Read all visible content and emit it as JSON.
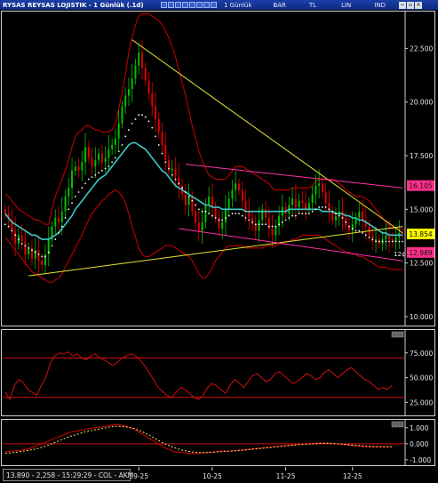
{
  "titlebar": {
    "title": "RYSAS REYSAS LOJISTIK - 1 Günlük (.1d)",
    "menu": [
      "1 Günlük",
      "BAR",
      "TL",
      "LIN",
      "IND"
    ],
    "controls": [
      "−",
      "▫",
      "×"
    ]
  },
  "status": {
    "text": "13.890 - 2,258 - 15:29:29 - COL - AKM"
  },
  "colors": {
    "background": "#000000",
    "candle_up": "#00c000",
    "candle_down": "#e00000",
    "bollinger": "#c00000",
    "moving_average": "#3cc8c8",
    "parabolic": "#ffffff",
    "trend_line": "#e6e632",
    "channel_line": "#ff2fa8",
    "level_yellow": "#ffff00",
    "level_pink": "#ff2f8a",
    "oscillator": "#d01010",
    "macd": "#c00000",
    "macd_signal": "#ffe070"
  },
  "chart_data": [
    {
      "type": "candlestick",
      "panel": "price",
      "ylim": [
        9.5,
        24.3
      ],
      "y_ticks": [
        "22.500",
        "20.000",
        "17.500",
        "15.000",
        "12.500",
        "10.000"
      ],
      "x_ticks": [
        "09-25",
        "10-25",
        "11-25",
        "12-25"
      ],
      "x_tick_positions": [
        40,
        62,
        84,
        104
      ],
      "n_bars": 120,
      "close": [
        14.8,
        14.5,
        14.0,
        13.4,
        13.8,
        13.5,
        12.9,
        13.2,
        12.7,
        13.1,
        12.6,
        12.4,
        12.9,
        13.6,
        14.2,
        14.6,
        14.4,
        14.9,
        15.6,
        16.0,
        16.8,
        17.0,
        16.8,
        17.2,
        17.9,
        17.4,
        17.0,
        17.3,
        17.6,
        17.2,
        17.4,
        17.8,
        18.0,
        18.3,
        19.0,
        19.8,
        20.3,
        20.6,
        21.1,
        21.7,
        22.3,
        21.6,
        21.0,
        20.4,
        19.8,
        19.2,
        18.6,
        18.0,
        17.3,
        16.8,
        16.9,
        16.5,
        16.1,
        15.7,
        15.2,
        15.6,
        14.9,
        14.4,
        14.0,
        14.4,
        15.2,
        15.6,
        15.1,
        14.6,
        14.1,
        14.4,
        15.0,
        15.5,
        15.9,
        16.2,
        15.9,
        15.4,
        14.9,
        14.6,
        14.3,
        14.0,
        14.5,
        15.0,
        14.6,
        14.1,
        13.8,
        14.2,
        14.7,
        15.1,
        14.8,
        15.2,
        15.5,
        15.1,
        15.4,
        15.3,
        15.0,
        15.3,
        15.7,
        16.1,
        16.2,
        15.8,
        15.3,
        14.9,
        14.5,
        14.7,
        14.9,
        14.6,
        14.2,
        14.0,
        14.3,
        14.6,
        14.9,
        14.5,
        14.2,
        13.8,
        13.5,
        13.6,
        13.4,
        13.6,
        13.8,
        13.6,
        13.5,
        13.7,
        13.9,
        13.85
      ],
      "bollinger_upper": [
        15.7,
        15.6,
        15.4,
        15.2,
        15.0,
        14.9,
        14.8,
        14.7,
        14.6,
        14.5,
        14.5,
        14.4,
        14.3,
        14.3,
        15.0,
        15.6,
        16.0,
        16.4,
        16.8,
        17.3,
        17.9,
        18.4,
        18.6,
        18.7,
        18.9,
        18.9,
        18.8,
        18.7,
        18.7,
        18.6,
        18.6,
        18.6,
        18.7,
        19.0,
        19.7,
        20.4,
        21.3,
        22.3,
        23.0,
        23.6,
        24.0,
        24.1,
        24.1,
        24.1,
        24.0,
        23.9,
        23.8,
        23.6,
        23.3,
        23.0,
        22.6,
        22.1,
        21.5,
        20.9,
        20.3,
        19.6,
        18.9,
        18.3,
        17.7,
        17.3,
        16.9,
        16.6,
        16.5,
        16.4,
        16.4,
        16.4,
        16.4,
        16.6,
        16.8,
        17.0,
        17.0,
        17.0,
        16.9,
        16.8,
        16.7,
        16.6,
        16.5,
        16.4,
        16.3,
        16.2,
        16.0,
        15.9,
        15.9,
        15.9,
        15.9,
        15.9,
        16.0,
        16.0,
        16.0,
        16.0,
        16.0,
        16.0,
        16.1,
        16.3,
        16.4,
        16.4,
        16.4,
        16.4,
        16.4,
        16.3,
        16.2,
        16.1,
        15.9,
        15.8,
        15.7,
        15.6,
        15.6,
        15.6,
        15.5,
        15.4,
        15.2,
        15.0,
        14.8,
        14.6,
        14.4,
        14.2,
        14.1,
        14.1,
        14.1,
        14.1
      ],
      "bollinger_lower": [
        13.7,
        13.5,
        13.3,
        13.1,
        12.9,
        12.7,
        12.5,
        12.3,
        12.1,
        12.0,
        11.9,
        11.8,
        11.7,
        11.6,
        11.6,
        11.7,
        11.8,
        12.0,
        12.3,
        12.6,
        12.9,
        13.2,
        13.5,
        13.8,
        14.2,
        14.5,
        14.8,
        15.0,
        15.2,
        15.4,
        15.5,
        15.7,
        15.8,
        15.9,
        15.8,
        15.6,
        15.3,
        14.8,
        14.2,
        13.7,
        13.2,
        12.9,
        12.8,
        12.8,
        12.9,
        13.0,
        13.1,
        13.2,
        13.3,
        13.3,
        13.3,
        13.2,
        13.1,
        13.0,
        12.9,
        12.8,
        12.6,
        12.3,
        12.0,
        11.8,
        11.8,
        12.0,
        12.3,
        12.6,
        12.8,
        13.0,
        13.2,
        13.3,
        13.3,
        13.3,
        13.3,
        13.3,
        13.2,
        13.2,
        13.2,
        13.2,
        13.2,
        13.2,
        13.3,
        13.3,
        13.3,
        13.3,
        13.4,
        13.4,
        13.5,
        13.5,
        13.6,
        13.6,
        13.7,
        13.8,
        13.8,
        13.8,
        13.8,
        13.8,
        13.8,
        13.7,
        13.6,
        13.5,
        13.4,
        13.3,
        13.2,
        13.1,
        13.0,
        13.0,
        12.9,
        12.9,
        12.8,
        12.8,
        12.7,
        12.6,
        12.5,
        12.4,
        12.3,
        12.3,
        12.3,
        12.2,
        12.2,
        12.2,
        12.2,
        12.2
      ],
      "moving_average": [
        14.8,
        14.6,
        14.4,
        14.3,
        14.2,
        14.1,
        14.0,
        13.9,
        13.8,
        13.8,
        13.7,
        13.6,
        13.6,
        13.6,
        13.7,
        13.8,
        13.9,
        14.1,
        14.3,
        14.5,
        14.7,
        15.0,
        15.2,
        15.4,
        15.6,
        15.8,
        16.0,
        16.2,
        16.4,
        16.5,
        16.6,
        16.8,
        17.0,
        17.2,
        17.4,
        17.6,
        17.8,
        18.0,
        18.1,
        18.1,
        18.0,
        17.9,
        17.8,
        17.6,
        17.4,
        17.2,
        17.0,
        16.8,
        16.7,
        16.5,
        16.3,
        16.1,
        16.0,
        15.9,
        15.8,
        15.7,
        15.6,
        15.5,
        15.4,
        15.3,
        15.2,
        15.2,
        15.1,
        15.1,
        15.1,
        15.0,
        15.0,
        15.0,
        15.0,
        15.0,
        15.0,
        15.0,
        14.9,
        14.9,
        14.9,
        14.9,
        14.9,
        14.9,
        14.9,
        14.9,
        14.9,
        14.9,
        14.9,
        14.9,
        14.9,
        15.0,
        15.0,
        15.0,
        15.0,
        15.0,
        15.0,
        15.0,
        15.0,
        15.0,
        15.0,
        14.9,
        14.9,
        14.9,
        14.9,
        14.8,
        14.8,
        14.8,
        14.7,
        14.7,
        14.6,
        14.6,
        14.5,
        14.5,
        14.4,
        14.3,
        14.2,
        14.1,
        14.0,
        13.9,
        13.9,
        13.8,
        13.8,
        13.8,
        13.8,
        13.8
      ],
      "parabolic_sar": [
        14.3,
        14.2,
        14.0,
        13.8,
        13.6,
        13.4,
        13.3,
        13.2,
        13.1,
        13.0,
        12.9,
        12.8,
        12.8,
        13.0,
        13.3,
        13.6,
        13.9,
        14.2,
        14.6,
        15.0,
        15.3,
        15.6,
        15.8,
        16.0,
        16.2,
        16.4,
        16.5,
        16.6,
        16.7,
        16.8,
        16.9,
        17.0,
        17.2,
        17.4,
        17.7,
        18.0,
        18.4,
        18.7,
        19.0,
        19.2,
        19.4,
        19.4,
        19.3,
        19.1,
        18.8,
        18.4,
        18.0,
        17.6,
        17.2,
        16.9,
        16.6,
        16.4,
        16.2,
        16.0,
        15.8,
        15.6,
        15.4,
        15.2,
        15.0,
        14.9,
        14.9,
        14.8,
        14.7,
        14.6,
        14.5,
        14.5,
        14.6,
        14.7,
        14.8,
        14.8,
        14.8,
        14.7,
        14.6,
        14.5,
        14.4,
        14.3,
        14.3,
        14.3,
        14.3,
        14.2,
        14.2,
        14.2,
        14.3,
        14.4,
        14.5,
        14.6,
        14.7,
        14.7,
        14.8,
        14.8,
        14.8,
        14.8,
        14.9,
        15.0,
        15.1,
        15.1,
        15.1,
        15.0,
        14.9,
        14.8,
        14.7,
        14.6,
        14.4,
        14.2,
        14.1,
        14.0,
        14.0,
        13.9,
        13.8,
        13.7,
        13.6,
        13.5,
        13.5,
        13.5,
        13.5,
        13.5,
        13.5,
        13.5,
        13.5,
        13.5
      ],
      "trend_lines": [
        {
          "color": "yellow",
          "from": [
            38,
            22.9
          ],
          "to": [
            119,
            13.9
          ]
        },
        {
          "color": "yellow",
          "from": [
            7,
            11.9
          ],
          "to": [
            119,
            14.2
          ]
        },
        {
          "color": "pink",
          "from": [
            54,
            17.1
          ],
          "to": [
            119,
            16.0
          ]
        },
        {
          "color": "pink",
          "from": [
            52,
            14.1
          ],
          "to": [
            119,
            12.6
          ]
        }
      ],
      "price_labels": [
        {
          "text": "16.105",
          "value": 16.105,
          "style": "pink"
        },
        {
          "text": "13.854",
          "value": 13.854,
          "style": "yellow"
        },
        {
          "text": "12.989",
          "value": 12.989,
          "style": "pink"
        },
        {
          "text": "12¢",
          "value": 12.95,
          "style": "small"
        }
      ]
    },
    {
      "type": "line",
      "panel": "oscillator",
      "ylim": [
        10,
        100
      ],
      "y_ticks": [
        "75.000",
        "50.000",
        "25.000"
      ],
      "levels": [
        70,
        30
      ],
      "values": [
        35,
        28,
        42,
        48,
        45,
        38,
        35,
        32,
        42,
        50,
        65,
        72,
        75,
        74,
        76,
        72,
        74,
        70,
        68,
        72,
        74,
        70,
        68,
        65,
        62,
        66,
        70,
        72,
        74,
        72,
        68,
        62,
        55,
        48,
        40,
        36,
        32,
        30,
        35,
        40,
        38,
        34,
        30,
        28,
        32,
        40,
        44,
        42,
        38,
        34,
        42,
        48,
        45,
        40,
        46,
        52,
        54,
        50,
        46,
        48,
        54,
        56,
        52,
        48,
        44,
        46,
        50,
        54,
        52,
        48,
        50,
        55,
        58,
        54,
        50,
        54,
        58,
        60,
        56,
        52,
        48,
        46,
        42,
        38,
        40,
        38,
        42
      ]
    },
    {
      "type": "line",
      "panel": "macd",
      "ylim": [
        -1.45,
        1.6
      ],
      "y_ticks": [
        "1.000",
        "0.000",
        "-1.000"
      ],
      "levels": [
        0
      ],
      "series": [
        {
          "key": "macd",
          "values": [
            -0.5,
            -0.45,
            -0.4,
            -0.3,
            -0.1,
            0.1,
            0.3,
            0.5,
            0.7,
            0.8,
            0.9,
            1.0,
            1.05,
            1.15,
            1.2,
            1.1,
            0.9,
            0.6,
            0.3,
            0.0,
            -0.3,
            -0.5,
            -0.55,
            -0.6,
            -0.6,
            -0.55,
            -0.5,
            -0.45,
            -0.45,
            -0.4,
            -0.35,
            -0.3,
            -0.25,
            -0.2,
            -0.15,
            -0.1,
            -0.05,
            0.0,
            0.02,
            0.05,
            0.05,
            0.0,
            -0.05,
            -0.1,
            -0.15,
            -0.2,
            -0.2,
            -0.2,
            -0.2
          ]
        },
        {
          "key": "signal",
          "values": [
            -0.6,
            -0.55,
            -0.48,
            -0.4,
            -0.3,
            -0.15,
            0.05,
            0.25,
            0.45,
            0.6,
            0.75,
            0.85,
            0.95,
            1.05,
            1.1,
            1.05,
            0.95,
            0.75,
            0.5,
            0.2,
            -0.05,
            -0.25,
            -0.4,
            -0.5,
            -0.55,
            -0.55,
            -0.52,
            -0.48,
            -0.46,
            -0.43,
            -0.38,
            -0.33,
            -0.28,
            -0.23,
            -0.18,
            -0.13,
            -0.08,
            -0.04,
            -0.01,
            0.02,
            0.03,
            0.01,
            -0.03,
            -0.08,
            -0.12,
            -0.16,
            -0.18,
            -0.19,
            -0.19
          ]
        }
      ]
    }
  ]
}
